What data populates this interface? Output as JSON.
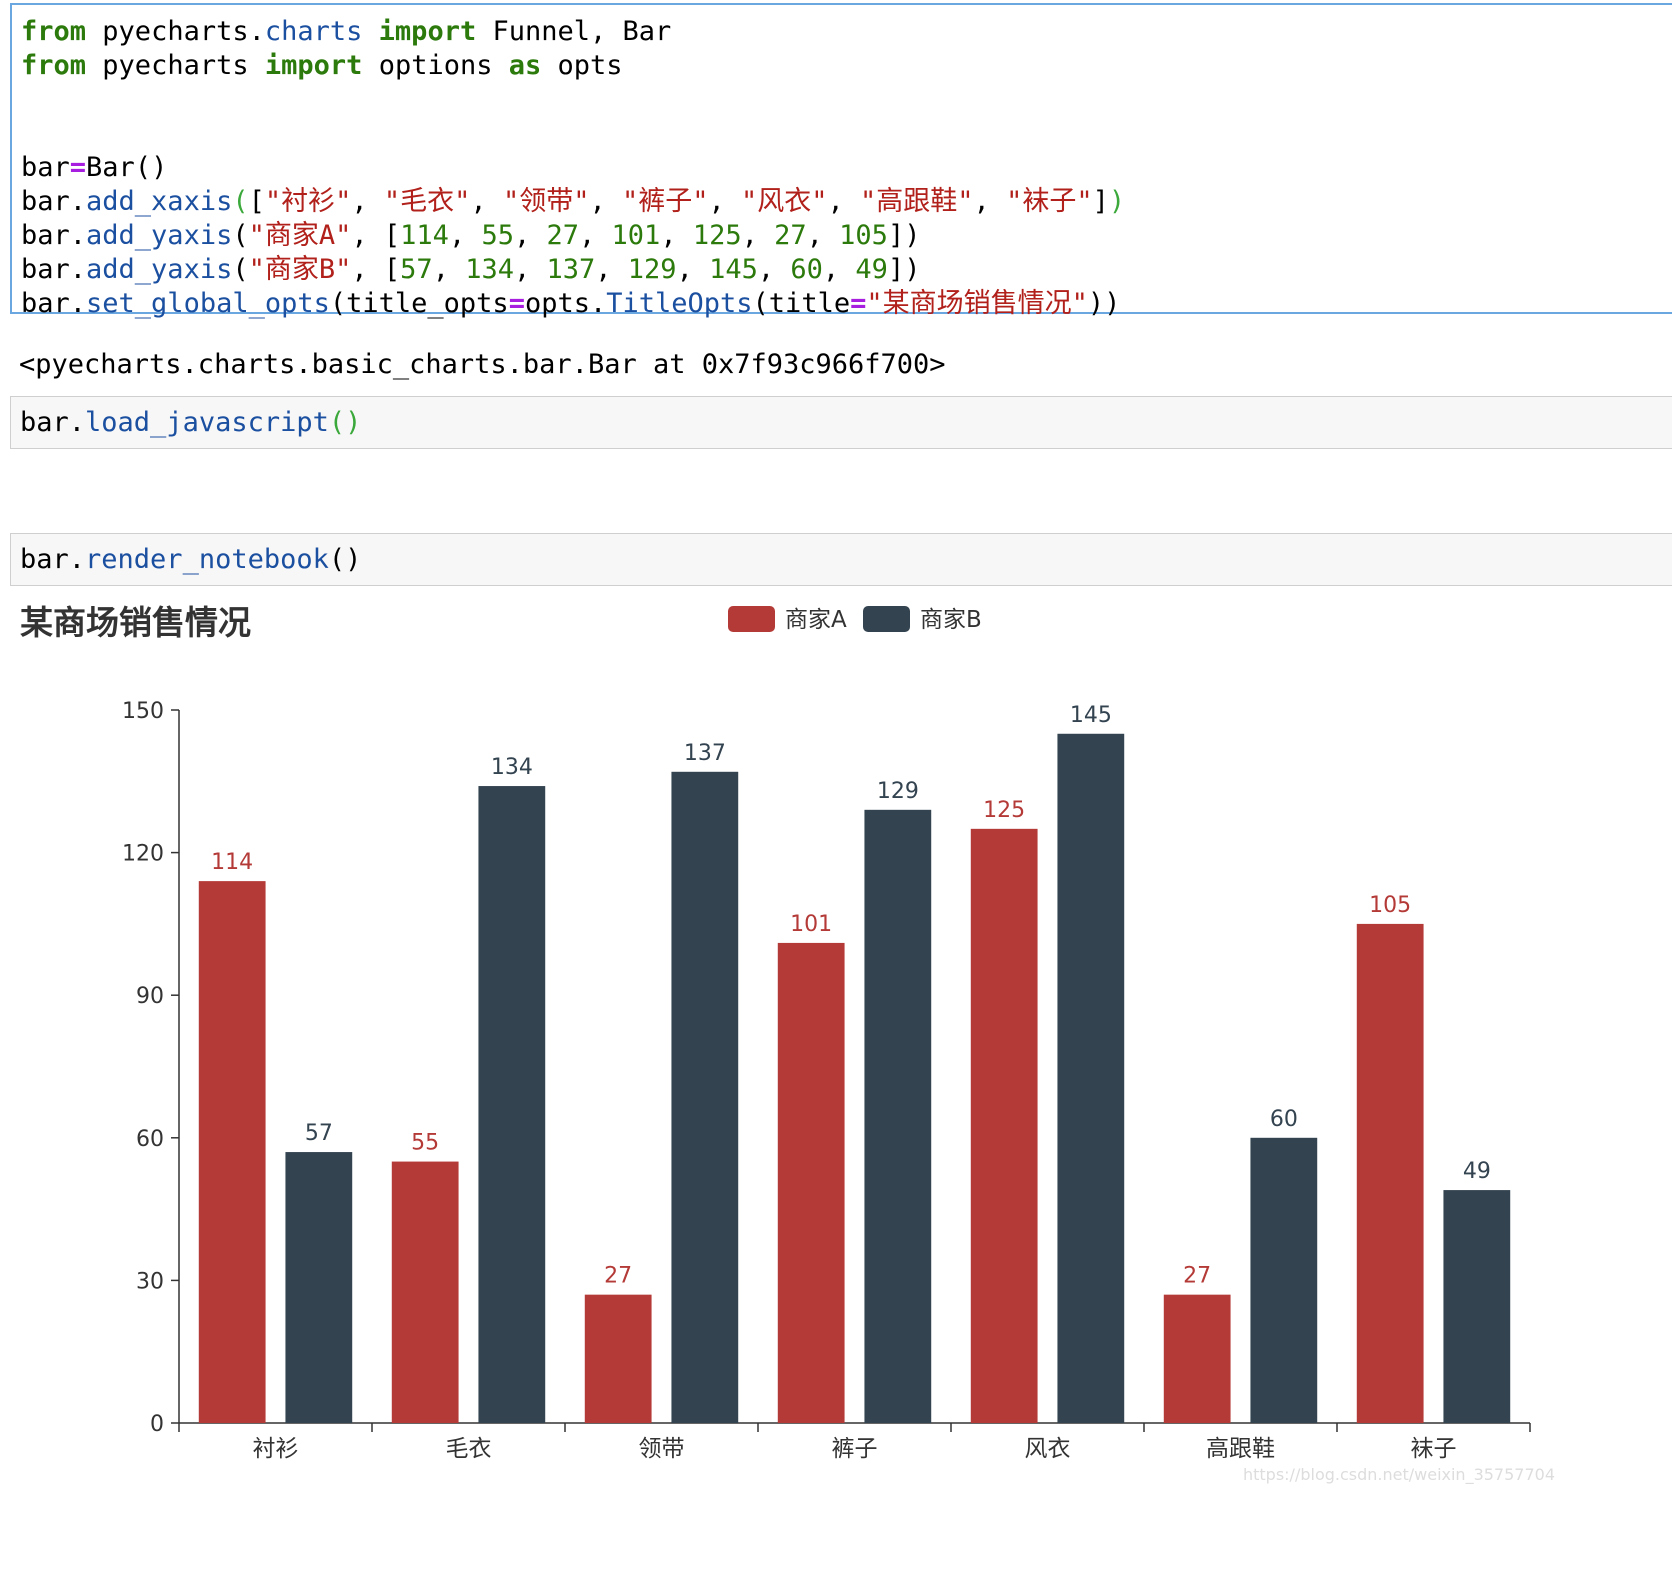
{
  "cells": {
    "cell1_lines": [
      [
        [
          "kw",
          "from"
        ],
        [
          "",
          "pyecharts."
        ],
        [
          "fn",
          "charts"
        ],
        [
          "",
          ""
        ],
        [
          "kw",
          "import"
        ],
        [
          "",
          "Funnel, Bar"
        ]
      ],
      [
        [
          "kw",
          "from"
        ],
        [
          "",
          "pyecharts"
        ],
        [
          "kw",
          "import"
        ],
        [
          "",
          "options"
        ],
        [
          "kw",
          "as"
        ],
        [
          "",
          "opts"
        ]
      ],
      [],
      [],
      [
        [
          "",
          "bar"
        ],
        [
          "op",
          "="
        ],
        [
          "",
          "Bar()"
        ]
      ],
      [
        [
          "",
          "bar."
        ],
        [
          "fn",
          "add_xaxis"
        ],
        [
          "br",
          "("
        ],
        [
          "",
          "["
        ],
        [
          "st",
          "\"衬衫\""
        ],
        [
          "",
          ", "
        ],
        [
          "st",
          "\"毛衣\""
        ],
        [
          "",
          ", "
        ],
        [
          "st",
          "\"领带\""
        ],
        [
          "",
          ", "
        ],
        [
          "st",
          "\"裤子\""
        ],
        [
          "",
          ", "
        ],
        [
          "st",
          "\"风衣\""
        ],
        [
          "",
          ", "
        ],
        [
          "st",
          "\"高跟鞋\""
        ],
        [
          "",
          ", "
        ],
        [
          "st",
          "\"袜子\""
        ],
        [
          "",
          "]"
        ],
        [
          "br",
          ")"
        ]
      ],
      [
        [
          "",
          "bar."
        ],
        [
          "fn",
          "add_yaxis"
        ],
        [
          "",
          "("
        ],
        [
          "st",
          "\"商家A\""
        ],
        [
          "",
          ", ["
        ],
        [
          "num",
          "114"
        ],
        [
          "",
          ", "
        ],
        [
          "num",
          "55"
        ],
        [
          "",
          ", "
        ],
        [
          "num",
          "27"
        ],
        [
          "",
          ", "
        ],
        [
          "num",
          "101"
        ],
        [
          "",
          ", "
        ],
        [
          "num",
          "125"
        ],
        [
          "",
          ", "
        ],
        [
          "num",
          "27"
        ],
        [
          "",
          ", "
        ],
        [
          "num",
          "105"
        ],
        [
          "",
          "])"
        ]
      ],
      [
        [
          "",
          "bar."
        ],
        [
          "fn",
          "add_yaxis"
        ],
        [
          "",
          "("
        ],
        [
          "st",
          "\"商家B\""
        ],
        [
          "",
          ", ["
        ],
        [
          "num",
          "57"
        ],
        [
          "",
          ", "
        ],
        [
          "num",
          "134"
        ],
        [
          "",
          ", "
        ],
        [
          "num",
          "137"
        ],
        [
          "",
          ", "
        ],
        [
          "num",
          "129"
        ],
        [
          "",
          ", "
        ],
        [
          "num",
          "145"
        ],
        [
          "",
          ", "
        ],
        [
          "num",
          "60"
        ],
        [
          "",
          ", "
        ],
        [
          "num",
          "49"
        ],
        [
          "",
          "])"
        ]
      ],
      [
        [
          "",
          "bar."
        ],
        [
          "fn",
          "set_global_opts"
        ],
        [
          "",
          "(title_opts"
        ],
        [
          "op",
          "="
        ],
        [
          "",
          "opts."
        ],
        [
          "fn",
          "TitleOpts"
        ],
        [
          "",
          "(title"
        ],
        [
          "op",
          "="
        ],
        [
          "st",
          "\"某商场销售情况\""
        ],
        [
          "",
          "))"
        ]
      ]
    ],
    "output_text": "<pyecharts.charts.basic_charts.bar.Bar at 0x7f93c966f700>",
    "cell2_lines": [
      [
        [
          "",
          "bar."
        ],
        [
          "fn",
          "load_javascript"
        ],
        [
          "br",
          "()"
        ]
      ]
    ],
    "cell3_lines": [
      [
        [
          "",
          "bar."
        ],
        [
          "fn",
          "render_notebook"
        ],
        [
          "",
          "()"
        ]
      ]
    ]
  },
  "watermark": "https://blog.csdn.net/weixin_35757704",
  "chart_data": {
    "type": "bar",
    "title": "某商场销售情况",
    "categories": [
      "衬衫",
      "毛衣",
      "领带",
      "裤子",
      "风衣",
      "高跟鞋",
      "袜子"
    ],
    "series": [
      {
        "name": "商家A",
        "values": [
          114,
          55,
          27,
          101,
          125,
          27,
          105
        ],
        "color": "#b43a37"
      },
      {
        "name": "商家B",
        "values": [
          57,
          134,
          137,
          129,
          145,
          60,
          49
        ],
        "color": "#334350"
      }
    ],
    "ylim": [
      0,
      150
    ],
    "yticks": [
      0,
      30,
      60,
      90,
      120,
      150
    ],
    "legend_position": "top-center",
    "grid": false
  }
}
